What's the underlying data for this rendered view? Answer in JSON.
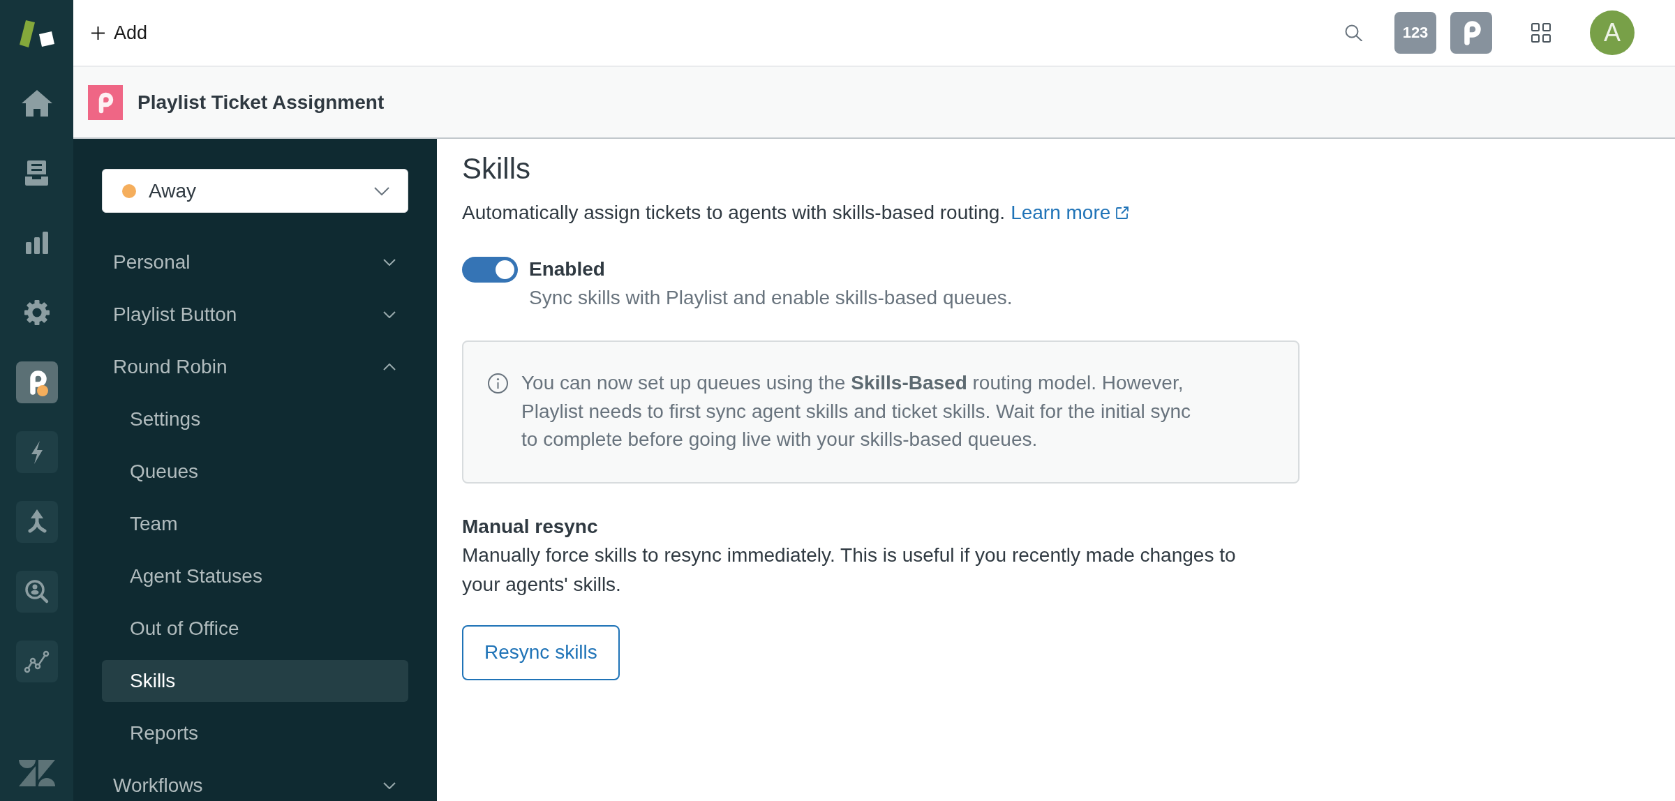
{
  "rail": {
    "nav": [
      {
        "kind": "home",
        "selected": false
      },
      {
        "kind": "views",
        "selected": false
      },
      {
        "kind": "reporting",
        "selected": false
      },
      {
        "kind": "admin",
        "selected": false
      }
    ],
    "apps": [
      {
        "kind": "playlist",
        "selected": true
      },
      {
        "kind": "bolt",
        "selected": false
      },
      {
        "kind": "merge",
        "selected": false
      },
      {
        "kind": "person-search",
        "selected": false
      },
      {
        "kind": "graph",
        "selected": false
      }
    ]
  },
  "topbar": {
    "add_label": "Add",
    "apps": [
      {
        "kind": "label",
        "label": "123"
      },
      {
        "kind": "playlist"
      }
    ],
    "avatar": "A"
  },
  "header": {
    "title": "Playlist Ticket Assignment"
  },
  "sidebar": {
    "status": {
      "label": "Away",
      "color": "#f5ae5c"
    },
    "items": [
      {
        "label": "Personal",
        "expanded": false
      },
      {
        "label": "Playlist Button",
        "expanded": false
      },
      {
        "label": "Round Robin",
        "expanded": true,
        "children": [
          {
            "label": "Settings",
            "selected": false
          },
          {
            "label": "Queues",
            "selected": false
          },
          {
            "label": "Team",
            "selected": false
          },
          {
            "label": "Agent Statuses",
            "selected": false
          },
          {
            "label": "Out of Office",
            "selected": false
          },
          {
            "label": "Skills",
            "selected": true
          },
          {
            "label": "Reports",
            "selected": false
          }
        ]
      },
      {
        "label": "Workflows",
        "expanded": false
      }
    ]
  },
  "content": {
    "title": "Skills",
    "description": "Automatically assign tickets to agents with skills-based routing.",
    "link": "Learn more",
    "toggle": {
      "label": "Enabled",
      "on": true,
      "hint": "Sync skills with Playlist and enable skills-based queues."
    },
    "notice": "You can now set up queues using the **Skills-Based** routing model. However, Playlist needs to first sync agent skills and ticket skills. Wait for the initial sync to complete before going live with your skills-based queues.",
    "resync": {
      "title": "Manual resync",
      "description": "Manually force skills to resync immediately. This is useful if you recently made changes to your agents' skills.",
      "button": "Resync skills"
    }
  }
}
